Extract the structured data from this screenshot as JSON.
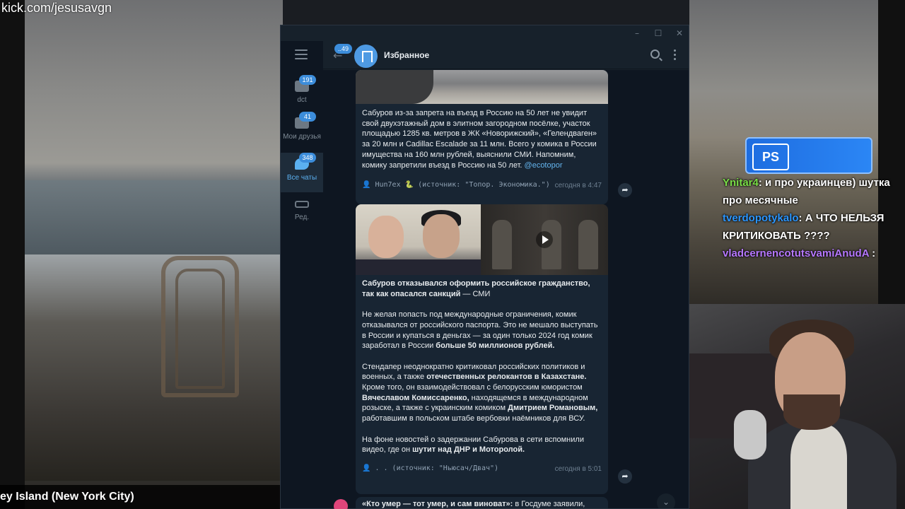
{
  "overlay": {
    "kick_url": "kick.com/jesusavgn",
    "location_caption": "ey Island (New York City)"
  },
  "stream_chat": {
    "ps_badge": "PS",
    "messages": [
      {
        "user": "Ynitar4",
        "text": ": и про украинцев) шутка про месячные",
        "color": "#7adf47"
      },
      {
        "user": "tverdopotykalo",
        "text": ": А ЧТО НЕЛЬЗЯ КРИТИКОВАТЬ ????",
        "color": "#2b96ff"
      },
      {
        "user": "vladcernencotutsvamiAnudA",
        "text": ":",
        "color": "#b678ff"
      }
    ]
  },
  "telegram": {
    "window_controls": {
      "minimize": "–",
      "maximize": "☐",
      "close": "✕"
    },
    "sidebar": {
      "menu_icon": "hamburger-icon",
      "folders": [
        {
          "label": "dct",
          "badge": "191"
        },
        {
          "label": "Мои друзья",
          "badge": "41"
        },
        {
          "label": "Все чаты",
          "badge": "348",
          "active": true
        },
        {
          "label": "Ред."
        }
      ]
    },
    "header": {
      "back_badge": "..49",
      "title": "Избранное"
    },
    "messages": [
      {
        "text": "Сабуров из-за запрета на въезд в Россию на 50 лет не увидит свой двухэтажный дом в элитном загородном посёлке, участок площадью 1285 кв. метров в ЖК «Новорижский», «Гелендваген» за 20 млн и Cadillac Escalade за 11 млн. Всего у комика в России имущества на 160 млн рублей, выяснили СМИ. Напомним, комику запретили въезд в Россию на 50 лет.",
        "link": "@ecotopor",
        "source": "👤 Hun7ex 🐍 (источник: \"Топор. Экономика.\")",
        "time": "сегодня в 4:47"
      },
      {
        "headline": "Сабуров отказывался оформить российское гражданство, так как опасался санкций",
        "headline_suffix": " — СМИ",
        "p1_a": "Не желая попасть под международные ограничения, комик отказывался от российского паспорта. Это не мешало выступать в России и купаться в деньгах — за один только 2024 год комик заработал в России ",
        "p1_b": "больше 50 миллионов рублей.",
        "p2_a": "Стендапер неоднократно критиковал российских политиков и военных, а также ",
        "p2_b": "отечественных релокантов в Казахстане.",
        "p2_c": " Кроме того, он взаимодействовал с белорусским юмористом ",
        "p2_d": "Вячеславом Комиссаренко,",
        "p2_e": " находящемся в международном розыске, а также с украинским комиком ",
        "p2_f": "Дмитрием Романовым,",
        "p2_g": " работавшим в польском штабе вербовки наёмников для ВСУ.",
        "p3_a": "На фоне новостей о задержании Сабурова в сети вспомнили видео, где он ",
        "p3_b": "шутит над ДНР и Моторолой.",
        "source": "👤 . . (источник: \"Ньюсач/Двач\")",
        "time": "сегодня в 5:01"
      },
      {
        "text_bold": "«Кто умер — тот умер, и сам виноват»:",
        "text": " в Госдуме заявили,"
      }
    ]
  }
}
